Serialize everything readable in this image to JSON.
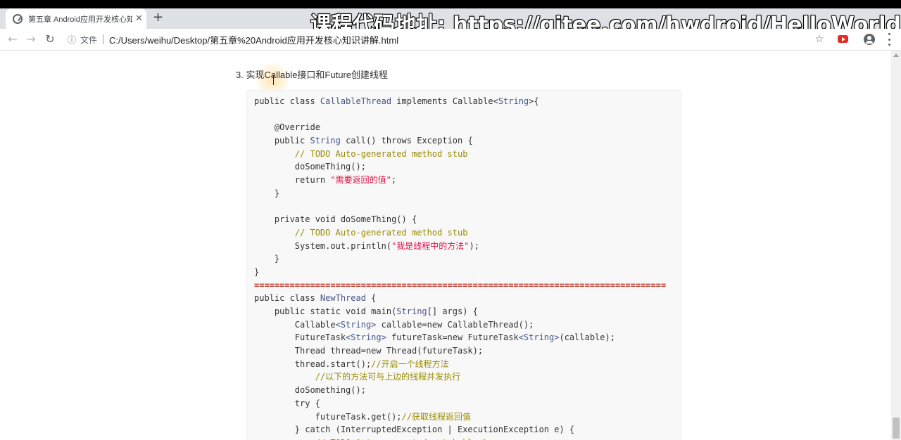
{
  "browser": {
    "tab_title": "第五章 Android应用开发核心知",
    "new_tab_symbol": "+",
    "close_symbol": "✕",
    "security_label": "文件",
    "url": "C:/Users/weihu/Desktop/第五章%20Android应用开发核心知识讲解.html"
  },
  "overlay": {
    "watermark": "课程代码地址: https://gitee.com/hwdroid/HelloWorld"
  },
  "page": {
    "heading": "3. 实现Callable接口和Future创建线程",
    "code_lines": [
      [
        {
          "t": "public class ",
          "c": "kw"
        },
        {
          "t": "CallableThread",
          "c": "cls"
        },
        {
          "t": " implements ",
          "c": "kw"
        },
        {
          "t": "Callable",
          "c": "kw"
        },
        {
          "t": "<",
          "c": "kw"
        },
        {
          "t": "String",
          "c": "cls"
        },
        {
          "t": ">{",
          "c": "kw"
        }
      ],
      [],
      [
        {
          "t": "    @Override",
          "c": "kw"
        }
      ],
      [
        {
          "t": "    public ",
          "c": "kw"
        },
        {
          "t": "String",
          "c": "cls"
        },
        {
          "t": " call() throws ",
          "c": "kw"
        },
        {
          "t": "Exception {",
          "c": "kw"
        }
      ],
      [
        {
          "t": "        // TODO Auto-generated method stub",
          "c": "comment"
        }
      ],
      [
        {
          "t": "        doSomeThing();",
          "c": "kw"
        }
      ],
      [
        {
          "t": "        return ",
          "c": "kw"
        },
        {
          "t": "\"需要返回的值\"",
          "c": "str"
        },
        {
          "t": ";",
          "c": "kw"
        }
      ],
      [
        {
          "t": "    }",
          "c": "kw"
        }
      ],
      [],
      [
        {
          "t": "    private void ",
          "c": "kw"
        },
        {
          "t": "doSomeThing() {",
          "c": "kw"
        }
      ],
      [
        {
          "t": "        // TODO Auto-generated method stub",
          "c": "comment"
        }
      ],
      [
        {
          "t": "        System.out.println(",
          "c": "kw"
        },
        {
          "t": "\"我是线程中的方法\"",
          "c": "str"
        },
        {
          "t": ");",
          "c": "kw"
        }
      ],
      [
        {
          "t": "    }",
          "c": "kw"
        }
      ],
      [
        {
          "t": "}",
          "c": "kw"
        }
      ],
      [
        {
          "t": "=================================================================================",
          "c": "sep-line"
        }
      ],
      [
        {
          "t": "public class ",
          "c": "kw"
        },
        {
          "t": "NewThread",
          "c": "cls"
        },
        {
          "t": " {",
          "c": "kw"
        }
      ],
      [
        {
          "t": "    public static void ",
          "c": "kw"
        },
        {
          "t": "main(",
          "c": "kw"
        },
        {
          "t": "String",
          "c": "cls"
        },
        {
          "t": "[] args) {",
          "c": "kw"
        }
      ],
      [
        {
          "t": "        Callable",
          "c": "kw"
        },
        {
          "t": "<String>",
          "c": "cls"
        },
        {
          "t": " callable=new CallableThread();",
          "c": "kw"
        }
      ],
      [
        {
          "t": "        FutureTask",
          "c": "kw"
        },
        {
          "t": "<String>",
          "c": "cls"
        },
        {
          "t": " futureTask=new FutureTask",
          "c": "kw"
        },
        {
          "t": "<String>",
          "c": "cls"
        },
        {
          "t": "(callable);",
          "c": "kw"
        }
      ],
      [
        {
          "t": "        Thread thread=new Thread(futureTask);",
          "c": "kw"
        }
      ],
      [
        {
          "t": "        thread.start();",
          "c": "kw"
        },
        {
          "t": "//开启一个线程方法",
          "c": "comment"
        }
      ],
      [
        {
          "t": "            //以下的方法可与上边的线程并发执行",
          "c": "comment"
        }
      ],
      [
        {
          "t": "        doSomething();",
          "c": "kw"
        }
      ],
      [
        {
          "t": "        try {",
          "c": "kw"
        }
      ],
      [
        {
          "t": "            futureTask.get();",
          "c": "kw"
        },
        {
          "t": "//获取线程返回值",
          "c": "comment"
        }
      ],
      [
        {
          "t": "        } catch (InterruptedException | ExecutionException e) {",
          "c": "kw"
        }
      ],
      [
        {
          "t": "            // TODO Auto-generated catch block",
          "c": "comment"
        }
      ]
    ]
  },
  "icons": [
    "back-icon",
    "forward-icon",
    "reload-icon",
    "info-icon",
    "star-icon",
    "youtube-icon",
    "avatar-icon",
    "menu-icon"
  ],
  "colors": {
    "keyword": "#333333",
    "type": "#445588",
    "comment": "#998a00",
    "string": "#d14",
    "separator": "#c0392b"
  }
}
